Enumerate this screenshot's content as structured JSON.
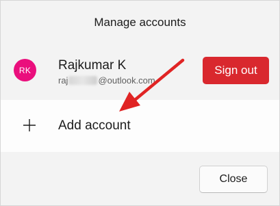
{
  "dialog": {
    "title": "Manage accounts"
  },
  "account": {
    "avatar_initials": "RK",
    "avatar_color": "#ea0f7d",
    "name": "Rajkumar K",
    "email_prefix": "raj",
    "email_suffix": "@outlook.com",
    "sign_out_label": "Sign out",
    "sign_out_color": "#d9282e"
  },
  "add_account": {
    "icon": "plus-icon",
    "label": "Add account"
  },
  "footer": {
    "close_label": "Close"
  },
  "annotation": {
    "arrow_color": "#e02424"
  }
}
